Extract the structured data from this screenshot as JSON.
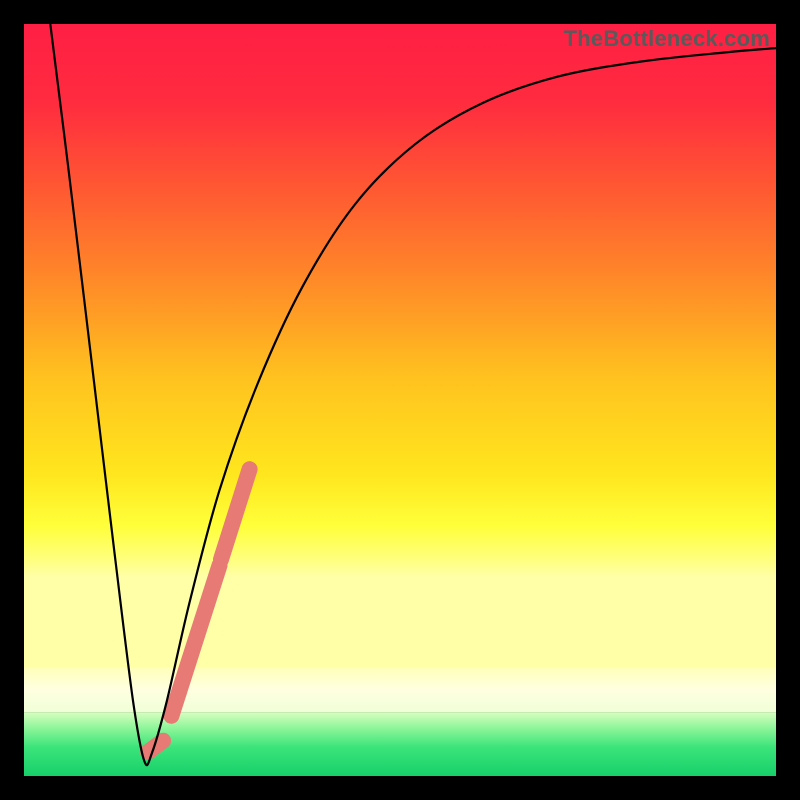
{
  "watermark": {
    "text": "TheBottleneck.com"
  },
  "gradient": {
    "stops": [
      {
        "offset": 0.0,
        "color": "#ff1f44"
      },
      {
        "offset": 0.12,
        "color": "#ff2b3f"
      },
      {
        "offset": 0.25,
        "color": "#ff5633"
      },
      {
        "offset": 0.4,
        "color": "#ff8a28"
      },
      {
        "offset": 0.55,
        "color": "#ffc21f"
      },
      {
        "offset": 0.7,
        "color": "#ffe61e"
      },
      {
        "offset": 0.78,
        "color": "#ffff3a"
      },
      {
        "offset": 0.83,
        "color": "#ffff7a"
      },
      {
        "offset": 0.86,
        "color": "#ffffa8"
      }
    ],
    "whitish_band": {
      "top_pct": 0.855,
      "bottom_pct": 0.915,
      "top_color": "#ffffb8",
      "mid_color": "#ffffe0",
      "bottom_color": "#f0ffd8"
    },
    "green_band": {
      "top_pct": 0.915,
      "bottom_pct": 1.0,
      "stops": [
        {
          "offset": 0.0,
          "color": "#d8ffc0"
        },
        {
          "offset": 0.25,
          "color": "#8ef59a"
        },
        {
          "offset": 0.55,
          "color": "#3be47a"
        },
        {
          "offset": 1.0,
          "color": "#17d06a"
        }
      ]
    }
  },
  "highlight": {
    "color": "#e77a74",
    "stroke_width": 16,
    "segments": [
      {
        "x1": 0.165,
        "y1": 0.968,
        "x2": 0.185,
        "y2": 0.953
      },
      {
        "x1": 0.196,
        "y1": 0.92,
        "x2": 0.26,
        "y2": 0.72
      },
      {
        "x1": 0.262,
        "y1": 0.712,
        "x2": 0.3,
        "y2": 0.592
      }
    ]
  },
  "chart_data": {
    "type": "line",
    "title": "",
    "xlabel": "",
    "ylabel": "",
    "xlim": [
      0,
      1
    ],
    "ylim": [
      0,
      1
    ],
    "series": [
      {
        "name": "bottleneck-curve",
        "points": [
          {
            "x": 0.035,
            "y": 1.0
          },
          {
            "x": 0.06,
            "y": 0.8
          },
          {
            "x": 0.09,
            "y": 0.55
          },
          {
            "x": 0.12,
            "y": 0.3
          },
          {
            "x": 0.145,
            "y": 0.1
          },
          {
            "x": 0.16,
            "y": 0.02
          },
          {
            "x": 0.17,
            "y": 0.03
          },
          {
            "x": 0.19,
            "y": 0.1
          },
          {
            "x": 0.22,
            "y": 0.23
          },
          {
            "x": 0.26,
            "y": 0.38
          },
          {
            "x": 0.31,
            "y": 0.52
          },
          {
            "x": 0.37,
            "y": 0.65
          },
          {
            "x": 0.44,
            "y": 0.76
          },
          {
            "x": 0.52,
            "y": 0.84
          },
          {
            "x": 0.61,
            "y": 0.895
          },
          {
            "x": 0.71,
            "y": 0.93
          },
          {
            "x": 0.82,
            "y": 0.95
          },
          {
            "x": 0.93,
            "y": 0.962
          },
          {
            "x": 1.0,
            "y": 0.968
          }
        ]
      }
    ]
  }
}
